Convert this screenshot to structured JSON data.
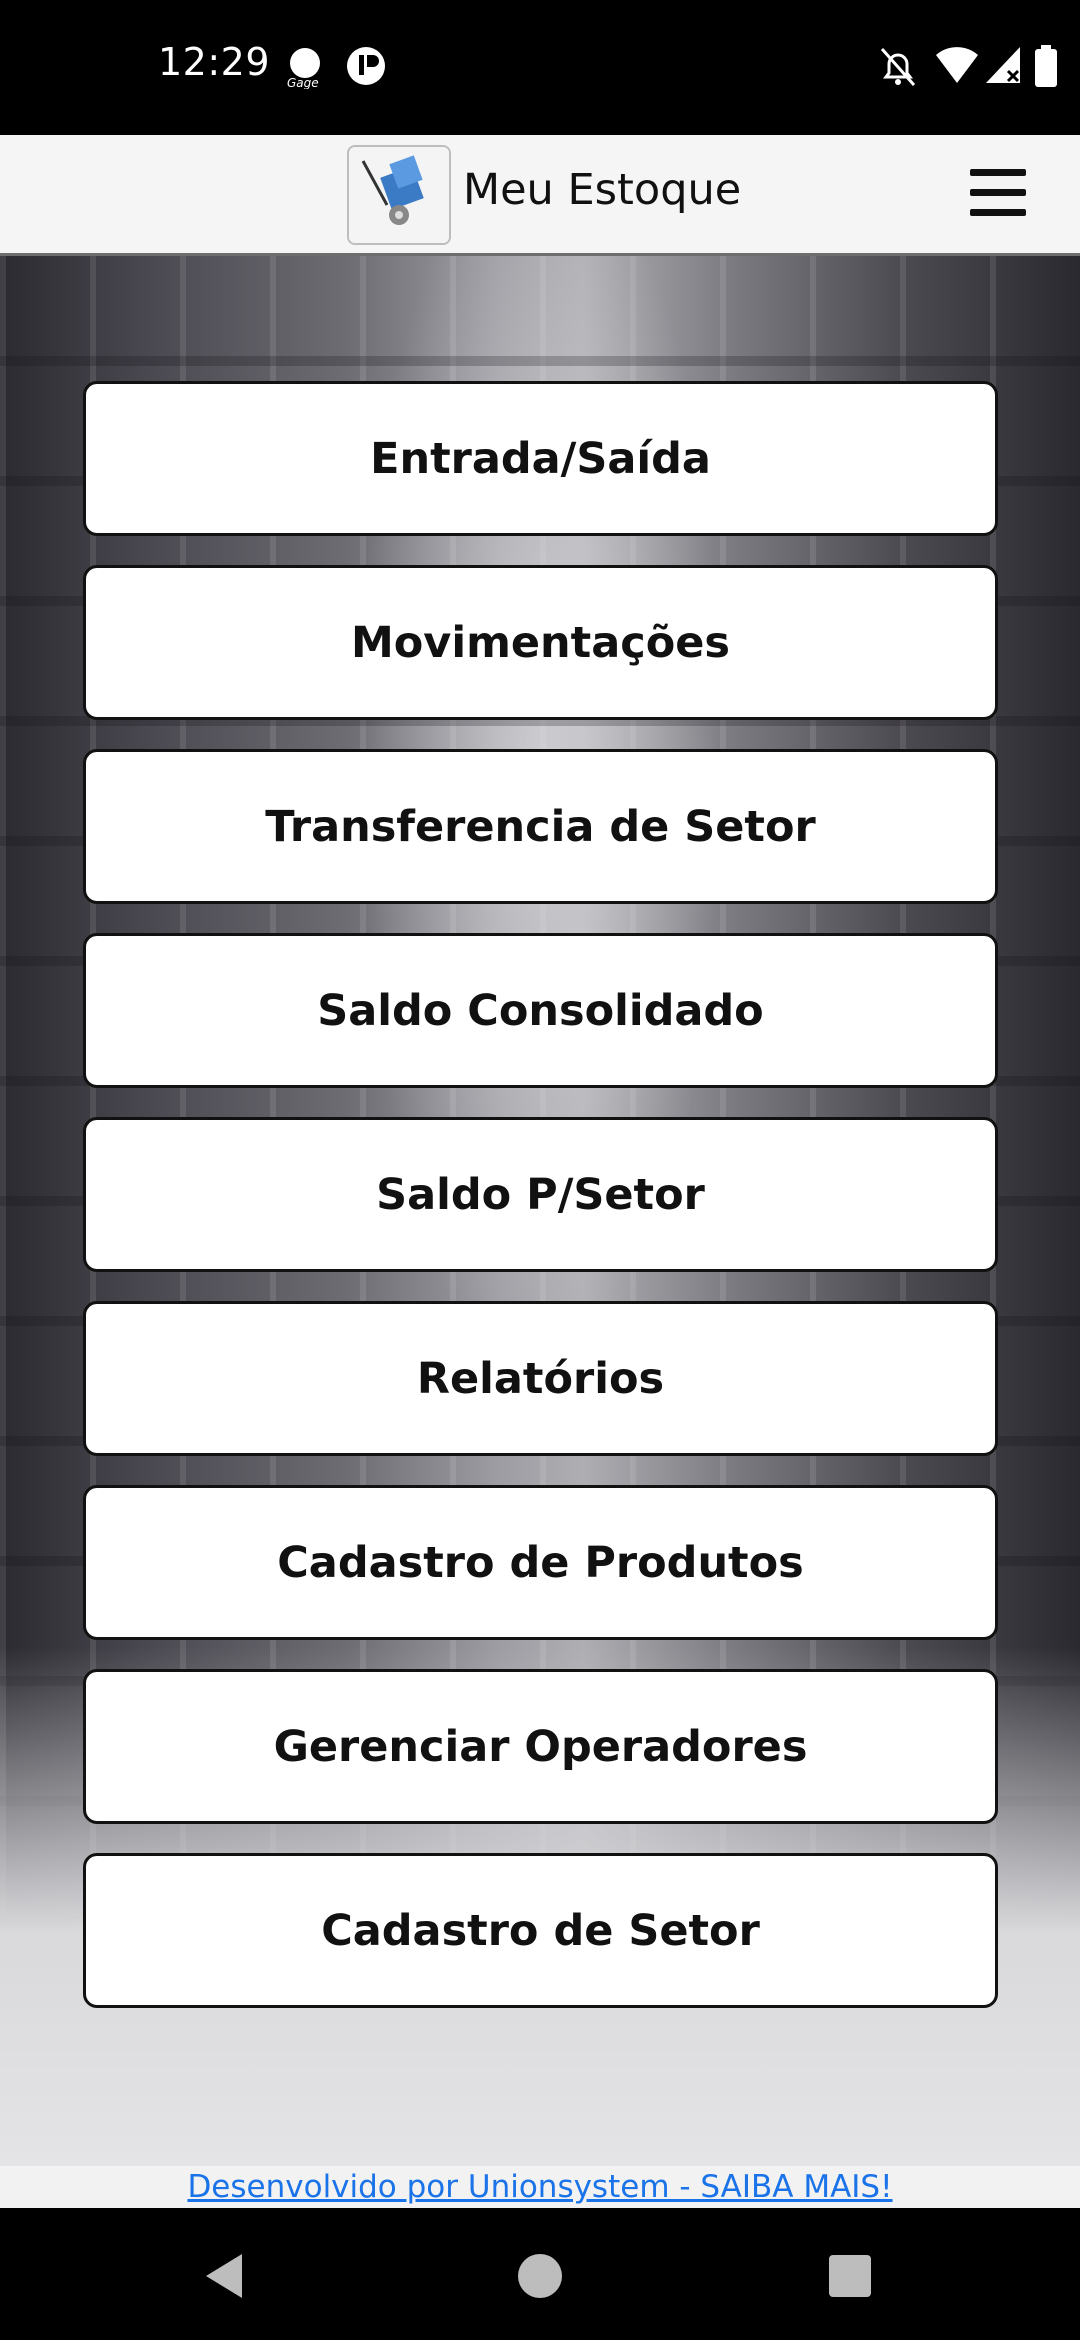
{
  "status_bar": {
    "time": "12:29",
    "icons": [
      "notification-app-icon",
      "media-app-icon",
      "do-not-disturb-off-icon",
      "wifi-icon",
      "signal-icon",
      "battery-icon"
    ]
  },
  "header": {
    "title": "Meu Estoque",
    "logo": "meu-estoque-logo",
    "menu_icon": "hamburger-menu-icon"
  },
  "menu": {
    "items": [
      {
        "label": "Entrada/Saída"
      },
      {
        "label": "Movimentações"
      },
      {
        "label": "Transferencia de Setor"
      },
      {
        "label": "Saldo Consolidado"
      },
      {
        "label": "Saldo P/Setor"
      },
      {
        "label": "Relatórios"
      },
      {
        "label": "Cadastro de Produtos"
      },
      {
        "label": "Gerenciar Operadores"
      },
      {
        "label": "Cadastro de Setor"
      }
    ]
  },
  "footer": {
    "link_text": "Desenvolvido por Unionsystem - SAIBA MAIS!"
  },
  "nav_bar": {
    "buttons": [
      "back-icon",
      "home-icon",
      "recents-icon"
    ]
  },
  "colors": {
    "link": "#1a73e8",
    "button_bg": "#ffffff",
    "button_border": "#111111",
    "header_bg": "#f5f5f5"
  }
}
